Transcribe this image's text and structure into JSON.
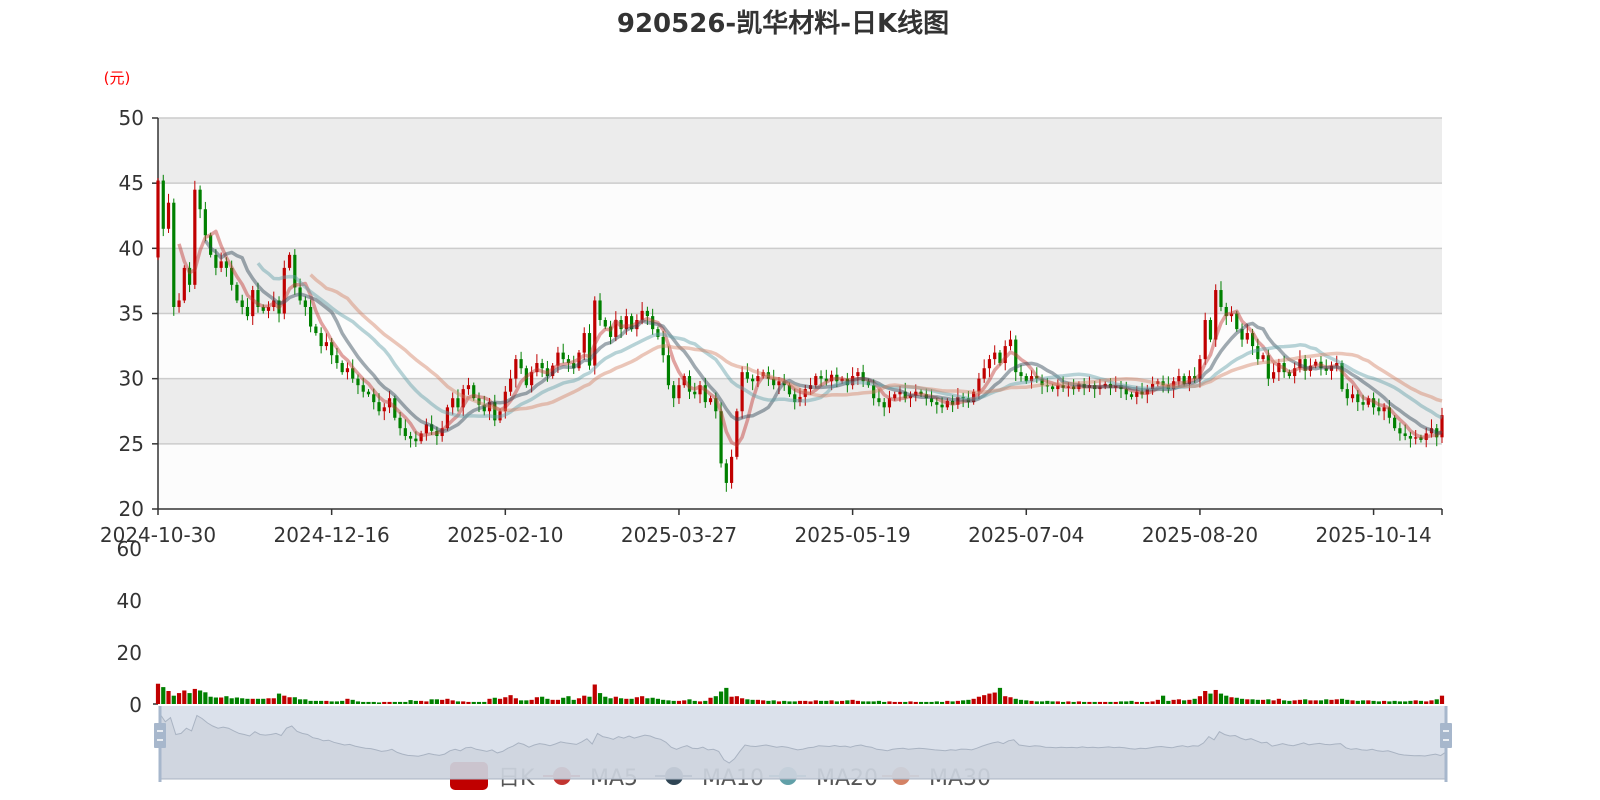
{
  "chart_data": {
    "type": "candlestick",
    "title": "920526-凯华材料-日K线图",
    "ylabel": "(元)",
    "ylim": [
      20,
      50
    ],
    "yticks": [
      "50",
      "45",
      "40",
      "35",
      "30",
      "25",
      "20"
    ],
    "volume_ylim": [
      0,
      60
    ],
    "volume_yticks": [
      "60",
      "40",
      "20",
      "0"
    ],
    "x_tick_labels": [
      "2024-10-30",
      "2024-12-16",
      "2025-02-10",
      "2025-03-27",
      "2025-05-19",
      "2025-07-04",
      "2025-08-20",
      "2025-10-14"
    ],
    "x_tick_interval_days": 33,
    "first_open": 39.3,
    "close": [
      45.2,
      41.5,
      43.5,
      35.5,
      36,
      38.5,
      37.2,
      44.5,
      43,
      41,
      39.5,
      38.5,
      39,
      38.5,
      37.2,
      36,
      35.5,
      34.8,
      36.8,
      35.5,
      35.2,
      35.5,
      36,
      35,
      38.5,
      39.5,
      37,
      36,
      35.5,
      34,
      33.5,
      32.5,
      32.8,
      31.8,
      31.2,
      30.5,
      30.8,
      30,
      29.5,
      29,
      28.8,
      28.2,
      27.5,
      27.8,
      28.5,
      27,
      26.2,
      25.6,
      25.4,
      25.2,
      25.8,
      26.5,
      26,
      25.6,
      26.2,
      27.8,
      28.5,
      27.8,
      29.2,
      29.5,
      28.5,
      28,
      27.5,
      28.2,
      26.8,
      27.5,
      29,
      30,
      31.5,
      30.8,
      29.5,
      30.5,
      31.2,
      30.8,
      30.2,
      31,
      32,
      31.5,
      31.2,
      30.8,
      32,
      33.5,
      31,
      36,
      34.5,
      34,
      33.2,
      34.5,
      33.8,
      34.8,
      33.8,
      34.5,
      35.2,
      34.8,
      33.8,
      33.2,
      31.8,
      29.5,
      28.5,
      29.5,
      30.2,
      29,
      28.8,
      29.5,
      28.2,
      28.5,
      27.5,
      23.5,
      22,
      24,
      27.5,
      30.5,
      30,
      29.8,
      30.2,
      30.5,
      30,
      29.5,
      29.8,
      29.5,
      28.8,
      28.2,
      28.6,
      29.2,
      29.5,
      30.2,
      30,
      29.8,
      30.3,
      29.8,
      30,
      29.5,
      30.2,
      30.5,
      29.8,
      29.5,
      28.5,
      28.2,
      27.8,
      28.5,
      28.8,
      29,
      28.5,
      28.7,
      29,
      28.8,
      28.5,
      28.2,
      28,
      27.8,
      28.3,
      28,
      28.6,
      28.5,
      28.2,
      29,
      30,
      30.8,
      31.5,
      32,
      31.2,
      32.5,
      33,
      30.5,
      30.2,
      29.8,
      30.2,
      30,
      29.5,
      29.4,
      29.2,
      29.5,
      29.3,
      29.4,
      29.2,
      29.6,
      29.3,
      29.5,
      29.2,
      29.4,
      29.6,
      29.3,
      29.5,
      29.2,
      28.8,
      28.6,
      29,
      28.8,
      29.2,
      29.6,
      29.8,
      29.5,
      29.2,
      29.8,
      30.2,
      29.6,
      30.2,
      30,
      31.5,
      34.5,
      33,
      36.8,
      35.5,
      34.8,
      35,
      33.8,
      33,
      33.5,
      32.5,
      31.5,
      31.8,
      30,
      30.5,
      31.2,
      30.5,
      30.2,
      30.8,
      31.5,
      30.6,
      31,
      31.3,
      30.8,
      30.6,
      31,
      31.2,
      29.2,
      28.5,
      28.8,
      28.2,
      28,
      28.5,
      27.8,
      27.5,
      27.8,
      27,
      26.2,
      25.8,
      25.6,
      25.4,
      25.5,
      25.3,
      25.8,
      26.2,
      25.5,
      27.2
    ],
    "volume": [
      7.8,
      6.5,
      5,
      3.2,
      4.2,
      5.2,
      4.2,
      5.8,
      5.2,
      4.5,
      2.8,
      2.5,
      2.5,
      3.0,
      2.2,
      2.5,
      2.2,
      2.0,
      2.0,
      2.0,
      2.0,
      2.2,
      2.2,
      4.0,
      3.2,
      2.6,
      2.6,
      1.8,
      1.8,
      1.2,
      1.2,
      1.2,
      1.2,
      1.0,
      1.0,
      1.2,
      2.0,
      1.6,
      1.0,
      0.8,
      0.8,
      0.8,
      0.6,
      0.8,
      0.8,
      0.8,
      0.8,
      0.8,
      1.5,
      1.2,
      1.2,
      1.0,
      1.8,
      1.8,
      1.6,
      2.0,
      1.4,
      1.0,
      1.0,
      0.8,
      0.8,
      0.8,
      0.8,
      2.0,
      2.4,
      2.0,
      2.6,
      3.4,
      2.2,
      1.4,
      1.4,
      1.6,
      2.6,
      2.8,
      2.0,
      1.6,
      1.6,
      2.4,
      3.0,
      1.6,
      2.2,
      3.2,
      2.8,
      7.5,
      4.2,
      2.8,
      2.2,
      2.8,
      2.2,
      2.0,
      2.0,
      2.6,
      3.0,
      2.2,
      2.4,
      2.0,
      1.6,
      1.4,
      1.2,
      1.2,
      1.4,
      1.8,
      1.2,
      1.0,
      1.2,
      2.4,
      3.0,
      4.8,
      6.2,
      2.8,
      3.0,
      2.2,
      1.8,
      1.6,
      1.6,
      1.4,
      1.2,
      1.4,
      1.0,
      1.2,
      1.0,
      1.0,
      1.2,
      1.2,
      1.0,
      1.4,
      1.2,
      1.2,
      1.4,
      1.0,
      1.2,
      1.4,
      1.6,
      1.2,
      1.0,
      1.0,
      1.0,
      1.2,
      0.8,
      1.0,
      0.8,
      0.8,
      0.8,
      1.0,
      0.8,
      0.8,
      0.8,
      0.8,
      1.0,
      0.8,
      1.2,
      1.0,
      1.2,
      1.4,
      1.6,
      2.0,
      2.8,
      3.4,
      4.0,
      4.4,
      6.2,
      3.0,
      2.6,
      2.0,
      1.6,
      1.4,
      1.2,
      1.0,
      1.0,
      1.2,
      1.0,
      1.0,
      0.8,
      1.0,
      0.8,
      1.0,
      0.8,
      0.8,
      0.8,
      0.8,
      0.8,
      0.8,
      0.8,
      1.0,
      1.0,
      1.2,
      0.8,
      0.8,
      0.8,
      1.0,
      1.6,
      3.2,
      1.2,
      1.6,
      1.8,
      1.4,
      1.6,
      2.0,
      3.0,
      5.0,
      4.0,
      5.4,
      4.0,
      3.2,
      2.6,
      2.4,
      2.0,
      1.8,
      1.8,
      1.6,
      1.6,
      1.8,
      1.4,
      2.0,
      1.4,
      1.2,
      1.4,
      1.6,
      1.8,
      1.4,
      1.4,
      1.4,
      1.8,
      1.6,
      1.8,
      2.0,
      1.6,
      1.4,
      1.2,
      1.4,
      1.4,
      1.2,
      1.0,
      1.2,
      1.0,
      1.2,
      1.0,
      1.0,
      1.2,
      1.4,
      1.2,
      1.0,
      1.4,
      1.8,
      3.2
    ],
    "legend": {
      "position": "bottom",
      "items": [
        {
          "label": "日K",
          "color": "#c00000"
        },
        {
          "label": "MA5",
          "color": "#c23531",
          "period": 5
        },
        {
          "label": "MA10",
          "color": "#2f4554",
          "period": 10
        },
        {
          "label": "MA20",
          "color": "#61a0a8",
          "period": 20
        },
        {
          "label": "MA30",
          "color": "#d48265",
          "period": 30
        }
      ]
    },
    "colors": {
      "up": "#c00000",
      "down": "#008000",
      "grid": "#cccccc",
      "unit_label": "#ff0000"
    }
  }
}
